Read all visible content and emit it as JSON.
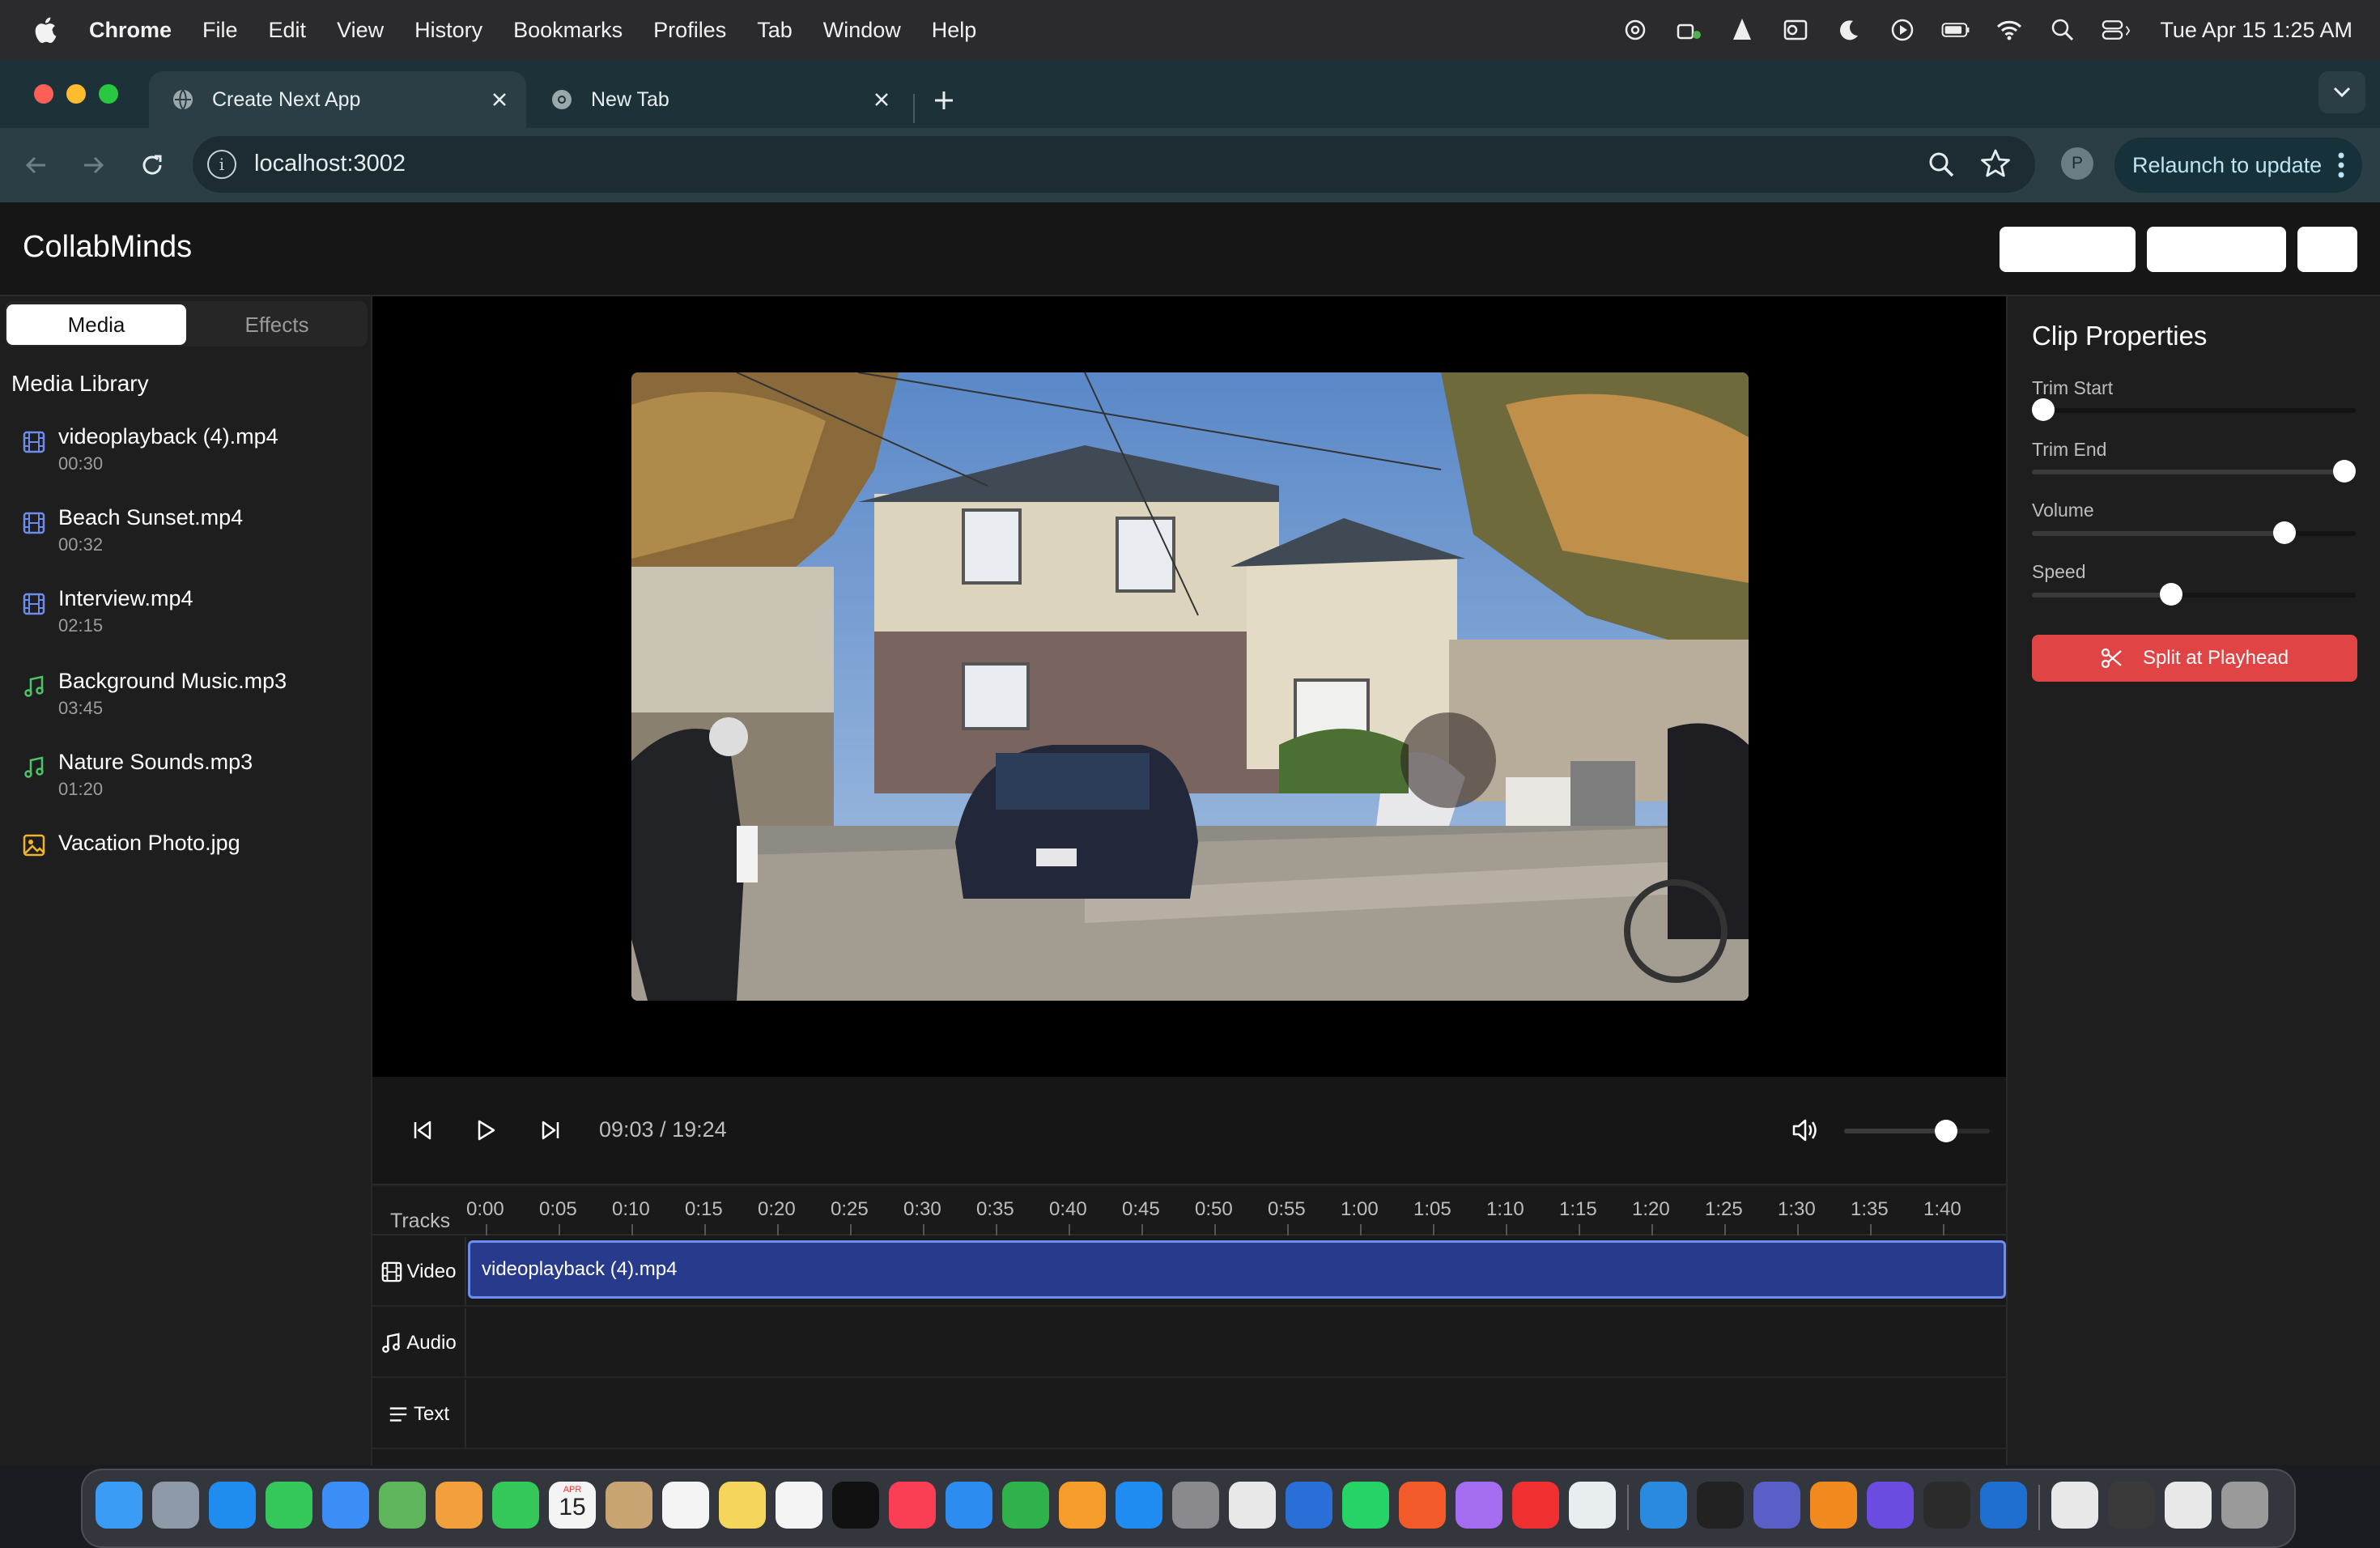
{
  "menubar": {
    "app_name": "Chrome",
    "items": [
      "File",
      "Edit",
      "View",
      "History",
      "Bookmarks",
      "Profiles",
      "Tab",
      "Window",
      "Help"
    ],
    "clock": "Tue Apr 15  1:25 AM"
  },
  "browser": {
    "tabs": [
      {
        "title": "Create Next App",
        "active": true
      },
      {
        "title": "New Tab",
        "active": false
      }
    ],
    "url": "localhost:3002",
    "profile_initial": "P",
    "relaunch_label": "Relaunch to update"
  },
  "app": {
    "brand": "CollabMinds",
    "left_tabs": [
      "Media",
      "Effects"
    ],
    "media_library_title": "Media Library",
    "media": [
      {
        "name": "videoplayback (4).mp4",
        "duration": "00:30",
        "icon": "film-icon"
      },
      {
        "name": "Beach Sunset.mp4",
        "duration": "00:32",
        "icon": "film-icon"
      },
      {
        "name": "Interview.mp4",
        "duration": "02:15",
        "icon": "film-icon"
      },
      {
        "name": "Background Music.mp3",
        "duration": "03:45",
        "icon": "music-icon"
      },
      {
        "name": "Nature Sounds.mp3",
        "duration": "01:20",
        "icon": "music-icon"
      },
      {
        "name": "Vacation Photo.jpg",
        "duration": "",
        "icon": "image-icon"
      }
    ],
    "player": {
      "time_readout": "09:03 / 19:24",
      "volume": 0.7
    },
    "timeline": {
      "tracks_label": "Tracks",
      "ticks": [
        "0:00",
        "0:05",
        "0:10",
        "0:15",
        "0:20",
        "0:25",
        "0:30",
        "0:35",
        "0:40",
        "0:45",
        "0:50",
        "0:55",
        "1:00",
        "1:05",
        "1:10",
        "1:15",
        "1:20",
        "1:25",
        "1:30",
        "1:35",
        "1:40"
      ],
      "tracks": [
        {
          "label": "Video",
          "icon": "film-icon"
        },
        {
          "label": "Audio",
          "icon": "music-icon"
        },
        {
          "label": "Text",
          "icon": "text-lines-icon"
        }
      ],
      "clip_name": "videoplayback (4).mp4"
    },
    "clip_properties": {
      "title": "Clip Properties",
      "trim_start_label": "Trim Start",
      "trim_start": 0.0,
      "trim_end_label": "Trim End",
      "trim_end": 1.0,
      "volume_label": "Volume",
      "volume": 0.78,
      "speed_label": "Speed",
      "speed": 0.43,
      "split_label": "Split at Playhead"
    }
  },
  "colors": {
    "accent_red": "#e04444",
    "clip_blue": "#273a8c",
    "chrome_frame": "#1d3138"
  },
  "dock": {
    "apps": [
      "finder-icon",
      "launchpad-icon",
      "safari-icon",
      "messages-icon",
      "mail-icon",
      "maps-icon",
      "photos-icon",
      "facetime-icon",
      "calendar-icon",
      "contacts-icon",
      "reminders-icon",
      "notes-icon",
      "freeform-icon",
      "tv-icon",
      "music-icon",
      "keynote-icon",
      "numbers-icon",
      "pages-icon",
      "app-store-icon",
      "system-settings-icon",
      "chrome-icon",
      "sourcetree-icon",
      "whatsapp-icon",
      "brave-icon",
      "chat-icon",
      "youtube-icon",
      "perplexity-icon",
      "vscode-icon",
      "terminal-icon",
      "teams-icon",
      "vlc-icon",
      "imovie-icon",
      "chatgpt-icon",
      "outlook-icon",
      "document-icon",
      "scanner-icon",
      "document-icon",
      "trash-icon"
    ],
    "calendar_day": "15",
    "calendar_month": "APR"
  }
}
